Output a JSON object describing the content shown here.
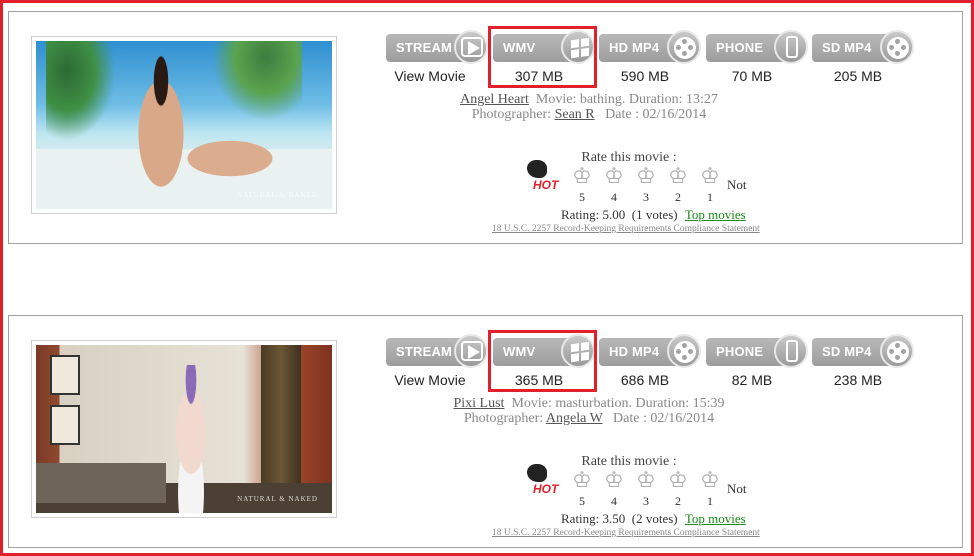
{
  "colors": {
    "highlight_border": "#e0202a",
    "button_gray": "#a8a8a8",
    "link_green": "#1a8a1a",
    "hot_red": "#e0202a"
  },
  "download_labels": {
    "stream": "STREAM",
    "wmv": "WMV",
    "hd": "HD MP4",
    "phone": "PHONE",
    "sd": "SD MP4"
  },
  "icons": {
    "stream": "play-icon",
    "wmv": "windows-icon",
    "hd": "film-reel-icon",
    "phone": "phone-icon",
    "sd": "film-reel-icon",
    "hot": "hot-bird-icon",
    "star": "crown-star-icon"
  },
  "rate_title": "Rate this movie :",
  "hot_label": "HOT",
  "not_label": "Not",
  "star_numbers": [
    "5",
    "4",
    "3",
    "2",
    "1"
  ],
  "top_movies_label": "Top movies",
  "compliance_text": "18 U.S.C. 2257 Record-Keeping Requirements Compliance Statement",
  "movies": [
    {
      "stream_text": "View Movie",
      "sizes": {
        "wmv": "307 MB",
        "hd": "590 MB",
        "phone": "70 MB",
        "sd": "205 MB"
      },
      "model": "Angel Heart",
      "movie_prefix": "Movie: bathing. Duration: 13:27",
      "photographer_prefix": "Photographer:",
      "photographer": "Sean R",
      "date_text": "Date : 02/16/2014",
      "rating_text": "Rating: 5.00",
      "votes_text": "(1 votes)",
      "watermark": "NATURAL & NAKED"
    },
    {
      "stream_text": "View Movie",
      "sizes": {
        "wmv": "365 MB",
        "hd": "686 MB",
        "phone": "82 MB",
        "sd": "238 MB"
      },
      "model": "Pixi Lust",
      "movie_prefix": "Movie: masturbation. Duration: 15:39",
      "photographer_prefix": "Photographer:",
      "photographer": "Angela W",
      "date_text": "Date : 02/16/2014",
      "rating_text": "Rating: 3.50",
      "votes_text": "(2 votes)",
      "watermark": "NATURAL & NAKED"
    }
  ]
}
